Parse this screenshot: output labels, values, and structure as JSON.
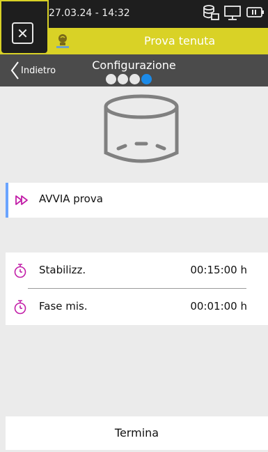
{
  "status": {
    "datetime": "27.03.24 - 14:32",
    "icons": [
      "database-icon",
      "monitor-icon",
      "battery-icon"
    ]
  },
  "header": {
    "mode_label": "Prova tenuta",
    "accent_color": "#d9d226"
  },
  "nav": {
    "back_label": "Indietro",
    "title": "Configurazione",
    "step_total": 4,
    "step_active": 4
  },
  "actions": {
    "start_label": "AVVIA prova"
  },
  "timing": [
    {
      "label": "Stabilizz.",
      "value": "00:15:00 h"
    },
    {
      "label": "Fase mis.",
      "value": "00:01:00 h"
    }
  ],
  "footer": {
    "end_label": "Termina"
  },
  "colors": {
    "accent_icon": "#c21ea8",
    "active_step": "#1b8ae8"
  }
}
